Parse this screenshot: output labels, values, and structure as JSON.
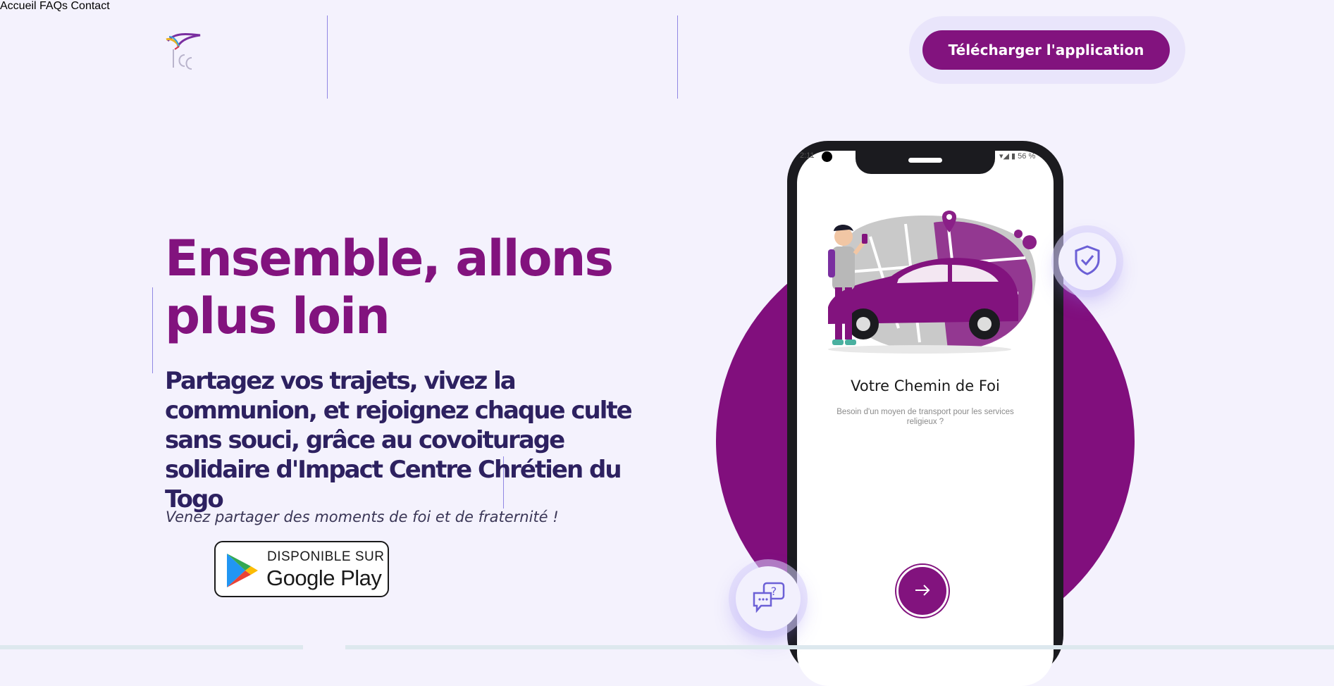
{
  "header": {
    "nav": [
      "Accueil",
      "FAQs",
      "Contact"
    ],
    "cta_label": "Télécharger l'application"
  },
  "hero": {
    "headline": "Ensemble, allons plus loin",
    "subheadline": "Partagez vos trajets, vivez la communion, et rejoignez chaque culte sans souci, grâce au covoiturage solidaire d'Impact Centre Chrétien du Togo",
    "tagline": "Venez partager des moments de foi et de fraternité !",
    "store_badge": {
      "top": "DISPONIBLE SUR",
      "main": "Google Play"
    }
  },
  "phone": {
    "status_time": "2:11",
    "status_battery": "56 %",
    "title": "Votre Chemin de Foi",
    "description": "Besoin d'un moyen de transport pour les services religieux ?",
    "next_icon": "arrow-right-icon"
  },
  "floating_icons": [
    "shield-check-icon",
    "chat-question-icon"
  ],
  "colors": {
    "primary": "#82137e",
    "heading_dark": "#2d2160",
    "background": "#f4f2fd"
  }
}
